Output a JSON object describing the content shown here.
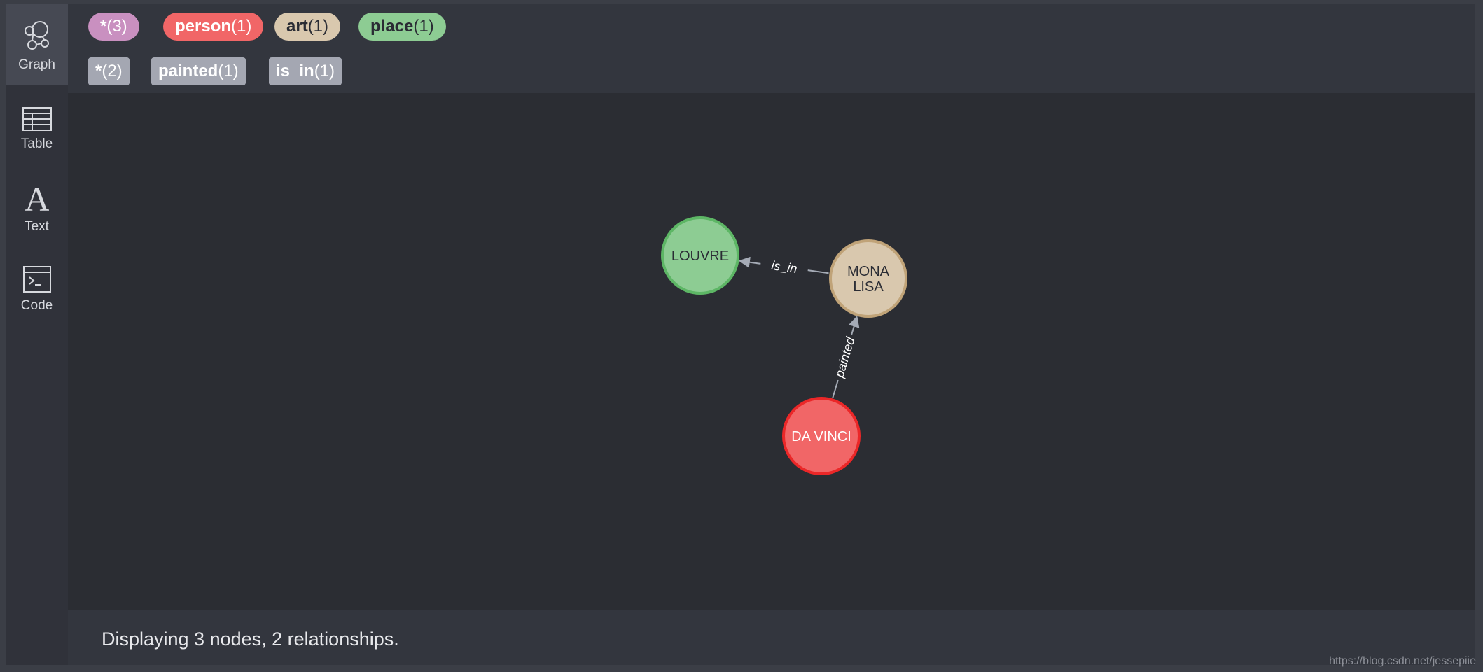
{
  "sidebar": {
    "items": [
      {
        "label": "Graph",
        "icon": "graph-icon",
        "active": true
      },
      {
        "label": "Table",
        "icon": "table-icon"
      },
      {
        "label": "Text",
        "icon": "text-icon"
      },
      {
        "label": "Code",
        "icon": "code-icon"
      }
    ]
  },
  "labels": [
    {
      "name": "*",
      "count": "(3)",
      "color": "#c990c0"
    },
    {
      "name": "person",
      "count": "(1)",
      "color": "#f16667"
    },
    {
      "name": "art",
      "count": "(1)",
      "color": "#d9c8ae"
    },
    {
      "name": "place",
      "count": "(1)",
      "color": "#8dcc93"
    }
  ],
  "relationships": [
    {
      "name": "*",
      "count": "(2)"
    },
    {
      "name": "painted",
      "count": "(1)"
    },
    {
      "name": "is_in",
      "count": "(1)"
    }
  ],
  "graph": {
    "nodes": [
      {
        "id": "louvre",
        "lines": [
          "LOUVRE"
        ],
        "fill": "#8dcc93",
        "stroke": "#5db665",
        "text_color": "#2a2c34"
      },
      {
        "id": "mona_lisa",
        "lines": [
          "MONA",
          "LISA"
        ],
        "fill": "#d9c8ae",
        "stroke": "#c0a378",
        "text_color": "#2a2c34"
      },
      {
        "id": "da_vinci",
        "lines": [
          "DA VINCI"
        ],
        "fill": "#f16667",
        "stroke": "#eb2728",
        "text_color": "#ffffff"
      }
    ],
    "edges": [
      {
        "from": "mona_lisa",
        "to": "louvre",
        "label": "is_in"
      },
      {
        "from": "da_vinci",
        "to": "mona_lisa",
        "label": "painted"
      }
    ],
    "edge_color": "#a5abb6"
  },
  "footer": {
    "status": "Displaying 3 nodes, 2 relationships."
  },
  "watermark": "https://blog.csdn.net/jessepiie"
}
